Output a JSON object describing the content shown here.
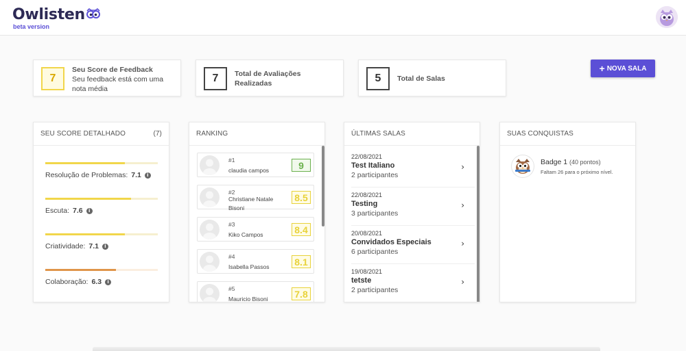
{
  "header": {
    "logo_text": "Owlisten",
    "logo_subtitle": "beta version"
  },
  "stats": {
    "feedback_score": {
      "value": "7",
      "title": "Seu Score de Feedback",
      "desc": "Seu feedback está com uma nota média"
    },
    "evaluations": {
      "value": "7",
      "title": "Total de Avaliações Realizadas"
    },
    "rooms": {
      "value": "5",
      "title": "Total de Salas"
    }
  },
  "new_room_button": "NOVA SALA",
  "score_panel": {
    "title": "SEU SCORE DETALHADO",
    "count": "(7)",
    "items": [
      {
        "label": "Resolução de Problemas:",
        "value": "7.1",
        "fill": 0.71,
        "color": "#f1d64a"
      },
      {
        "label": "Escuta:",
        "value": "7.6",
        "fill": 0.76,
        "color": "#f1d64a"
      },
      {
        "label": "Criatividade:",
        "value": "7.1",
        "fill": 0.71,
        "color": "#f1d64a"
      },
      {
        "label": "Colaboração:",
        "value": "6.3",
        "fill": 0.63,
        "color": "#e0954a"
      }
    ]
  },
  "ranking": {
    "title": "RANKING",
    "rows": [
      {
        "pos": "#1",
        "name": "claudia campos",
        "score": "9",
        "color": "#6ab04c",
        "bg": "#f1f9ec"
      },
      {
        "pos": "#2",
        "name": "Christiane Natale Bisoni",
        "score": "8.5",
        "color": "#e8d23a",
        "bg": "#fffce5"
      },
      {
        "pos": "#3",
        "name": "Kiko Campos",
        "score": "8.4",
        "color": "#e8d23a",
        "bg": "#fffce5"
      },
      {
        "pos": "#4",
        "name": "Isabella Passos",
        "score": "8.1",
        "color": "#e8d23a",
        "bg": "#fffce5"
      },
      {
        "pos": "#5",
        "name": "Mauricio Bisoni",
        "score": "7.8",
        "color": "#e8d23a",
        "bg": "#fffce5"
      }
    ]
  },
  "recent_rooms": {
    "title": "ÚLTIMAS SALAS",
    "rows": [
      {
        "date": "22/08/2021",
        "title": "Test Italiano",
        "participants": "2 participantes"
      },
      {
        "date": "22/08/2021",
        "title": "Testing",
        "participants": "3 participantes"
      },
      {
        "date": "20/08/2021",
        "title": "Convidados Especiais",
        "participants": "6 participantes"
      },
      {
        "date": "19/08/2021",
        "title": "tetste",
        "participants": "2 participantes"
      }
    ]
  },
  "achievements": {
    "title": "SUAS CONQUISTAS",
    "badge_title": "Badge 1",
    "badge_points": "(40 pontos)",
    "badge_sub": "Faltam 26 para o próximo nível."
  },
  "colors": {
    "accent": "#5b4fd6",
    "score_yellow": "#f1d64a",
    "score_orange": "#e0954a",
    "rank_green": "#6ab04c"
  }
}
